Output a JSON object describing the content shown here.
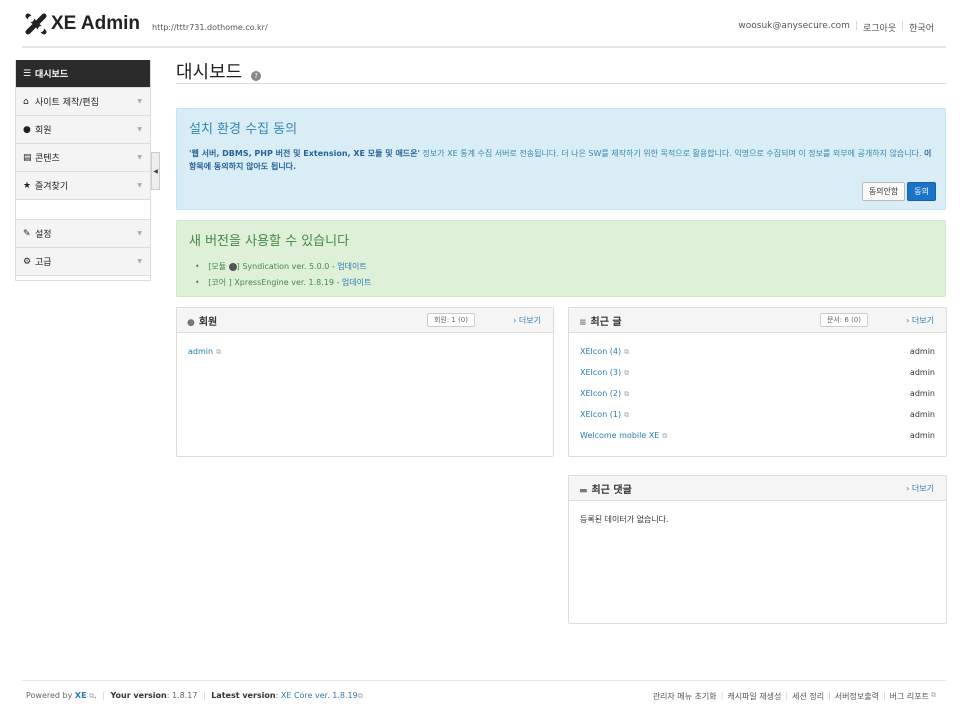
{
  "header": {
    "logo_text": "XE Admin",
    "site_url": "http://tttr731.dothome.co.kr/",
    "user_email": "woosuk@anysecure.com",
    "logout": "로그아웃",
    "language": "한국어"
  },
  "sidebar": {
    "items": [
      {
        "label": "대시보드",
        "icon": "list-icon"
      },
      {
        "label": "사이트 제작/편집",
        "icon": "home-icon"
      },
      {
        "label": "회원",
        "icon": "user-icon"
      },
      {
        "label": "콘텐츠",
        "icon": "document-icon"
      },
      {
        "label": "즐겨찾기",
        "icon": "star-icon"
      },
      {
        "label": "설정",
        "icon": "wrench-icon"
      },
      {
        "label": "고급",
        "icon": "gear-icon"
      }
    ]
  },
  "page": {
    "title": "대시보드"
  },
  "consent": {
    "title": "설치 환경 수집 동의",
    "bold_lead": "'웹 서버, DBMS, PHP 버전 및 Extension, XE 모듈 및 애드온'",
    "text1": " 정보가 XE 통계 수집 서버로 전송됩니다. 더 나은 SW를 제작하기 위한 목적으로 활용합니다. 익명으로 수집되며 이 정보를 외부에 공개하지 않습니다. ",
    "bold_tail": "이 항목에 동의하지 않아도 됩니다.",
    "decline": "동의안함",
    "agree": "동의"
  },
  "update": {
    "title": "새 버전을 사용할 수 있습니다",
    "items": [
      {
        "prefix": "[모듈",
        "suffix": "] Syndication ver. 5.0.0 - ",
        "link": "업데이트"
      },
      {
        "prefix": "[코어 ] XpressEngine ver. 1.8.19 - ",
        "link": "업데이트"
      }
    ]
  },
  "members_panel": {
    "title": "회원",
    "count": "회원: 1 (0)",
    "more": "› 더보기",
    "rows": [
      "admin"
    ]
  },
  "docs_panel": {
    "title": "최근 글",
    "count": "문서: 6 (0)",
    "more": "› 더보기",
    "rows": [
      {
        "title": "XEIcon (4)",
        "author": "admin"
      },
      {
        "title": "XEIcon (3)",
        "author": "admin"
      },
      {
        "title": "XEIcon (2)",
        "author": "admin"
      },
      {
        "title": "XEIcon (1)",
        "author": "admin"
      },
      {
        "title": "Welcome mobile XE",
        "author": "admin"
      }
    ]
  },
  "comments_panel": {
    "title": "최근 댓글",
    "more": "› 더보기",
    "empty": "등록된 데이터가 없습니다."
  },
  "footer": {
    "powered_by": "Powered by",
    "xe": "XE",
    "your_version_label": "Your version",
    "your_version": ": 1.8.17",
    "latest_label": "Latest version",
    "latest_value": "XE Core ver. 1.8.19",
    "links": [
      "관리자 메뉴 초기화",
      "캐시파일 재생성",
      "세션 정리",
      "서버정보출력",
      "버그 리포트"
    ]
  },
  "colors": {
    "accent": "#1a73c8",
    "info_bg": "#d9edf7",
    "success_bg": "#dff0d8",
    "sidebar_active": "#2b2b2b"
  }
}
